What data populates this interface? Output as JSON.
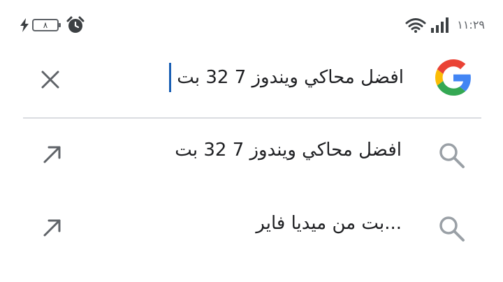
{
  "status_bar": {
    "battery_level": "٨",
    "time": "١١:٢٩",
    "icons": [
      "charging-bolt-icon",
      "battery-icon",
      "alarm-clock-icon",
      "wifi-icon",
      "cellular-signal-icon"
    ]
  },
  "search": {
    "query": "افضل محاكي ويندوز 7 32 بت",
    "logo": "google-g-logo",
    "clear_icon": "close-icon"
  },
  "suggestions": [
    {
      "text": "افضل محاكي ويندوز 7 32 بت",
      "leading_icon": "search-icon",
      "action_icon": "arrow-up-left-icon"
    },
    {
      "text": "...بت من ميديا فاير",
      "leading_icon": "search-icon",
      "action_icon": "arrow-up-left-icon"
    }
  ],
  "colors": {
    "text": "#202124",
    "icon": "#5f6368",
    "suggestion_icon": "#9aa0a6",
    "caret": "#1a5fb4",
    "divider": "#dadce0",
    "google_blue": "#4285F4",
    "google_red": "#EA4335",
    "google_yellow": "#FBBC05",
    "google_green": "#34A853"
  }
}
